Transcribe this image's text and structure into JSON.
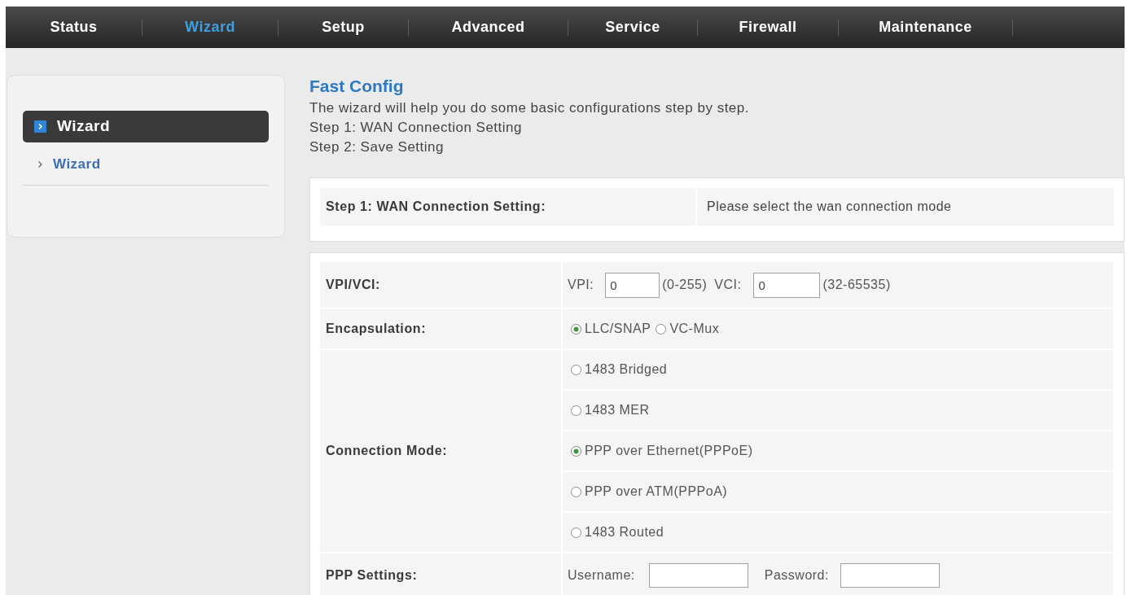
{
  "nav": {
    "tabs": [
      {
        "label": "Status",
        "selected": false
      },
      {
        "label": "Wizard",
        "selected": true
      },
      {
        "label": "Setup",
        "selected": false
      },
      {
        "label": "Advanced",
        "selected": false
      },
      {
        "label": "Service",
        "selected": false
      },
      {
        "label": "Firewall",
        "selected": false
      },
      {
        "label": "Maintenance",
        "selected": false
      }
    ]
  },
  "sidebar": {
    "header": "Wizard",
    "items": [
      {
        "label": "Wizard"
      }
    ]
  },
  "content": {
    "title": "Fast Config",
    "intro": "The wizard will help you do some basic configurations step by step.",
    "steps": [
      "Step 1: WAN Connection Setting",
      "Step 2: Save Setting"
    ]
  },
  "step_panel": {
    "heading": "Step 1: WAN Connection Setting:",
    "hint": "Please select the wan connection mode"
  },
  "form": {
    "vpi_vci": {
      "label": "VPI/VCI:",
      "vpi": {
        "label": "VPI:",
        "value": "0",
        "range": "(0-255)"
      },
      "vci": {
        "label": "VCI:",
        "value": "0",
        "range": "(32-65535)"
      }
    },
    "encapsulation": {
      "label": "Encapsulation:",
      "options": [
        {
          "label": "LLC/SNAP",
          "selected": true
        },
        {
          "label": "VC-Mux",
          "selected": false
        }
      ]
    },
    "connection_mode": {
      "label": "Connection Mode:",
      "options": [
        {
          "label": "1483 Bridged",
          "selected": false
        },
        {
          "label": "1483 MER",
          "selected": false
        },
        {
          "label": "PPP over Ethernet(PPPoE)",
          "selected": true
        },
        {
          "label": "PPP over ATM(PPPoA)",
          "selected": false
        },
        {
          "label": "1483 Routed",
          "selected": false
        }
      ]
    },
    "ppp_settings": {
      "label": "PPP Settings:",
      "username": {
        "label": "Username:"
      },
      "password": {
        "label": "Password:"
      }
    }
  }
}
